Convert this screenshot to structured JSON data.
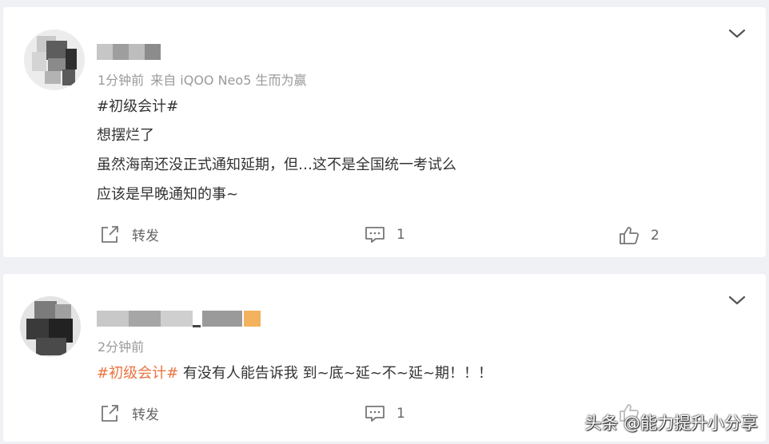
{
  "posts": [
    {
      "time": "1分钟前",
      "source": "来自 iQOO Neo5 生而为赢",
      "hashtag": "#初级会计#",
      "lines": [
        "想摆烂了",
        "虽然海南还没正式通知延期，但…这不是全国统一考试么",
        "应该是早晚通知的事~"
      ],
      "repost_label": "转发",
      "comment_count": "1",
      "like_count": "2"
    },
    {
      "time": "2分钟前",
      "hashtag": "#初级会计#",
      "text": " 有没有人能告诉我 到~底~延~不~延~期！！！",
      "repost_label": "转发",
      "comment_count": "1"
    }
  ],
  "watermark": "头条 @能力提升小分享",
  "colors": {
    "hashtag": "#eb7340",
    "meta": "#9a9a9a",
    "background": "#f0f1f4"
  },
  "icons": [
    "chevron-down-icon",
    "repost-icon",
    "comment-icon",
    "like-icon"
  ]
}
